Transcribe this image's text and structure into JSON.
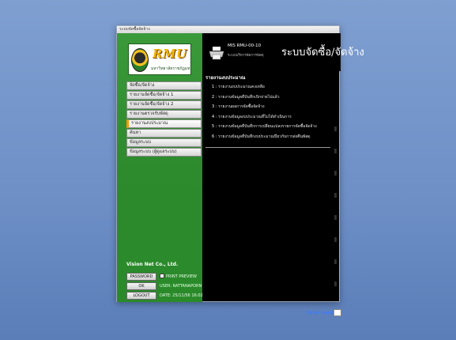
{
  "window": {
    "title": "ระบบจัดซื้อจัดจ้าง"
  },
  "logo": {
    "brand": "RMU",
    "subtitle": "มหาวิทยาลัยราชภัฏมหาสารคาม"
  },
  "sidebar": {
    "items": [
      {
        "label": "จัดซื้อ/จัดจ้าง",
        "active": false
      },
      {
        "label": "รายงานจัดซื้อ/จัดจ้าง 1",
        "active": false
      },
      {
        "label": "รายงานจัดซื้อ/จัดจ้าง 2",
        "active": false
      },
      {
        "label": "รายงานตรวจรับพัสดุ",
        "active": false
      },
      {
        "label": "รายงานงบประมาณ",
        "active": true
      },
      {
        "label": "ค้นหา",
        "active": false
      },
      {
        "label": "ข้อมูลระบบ",
        "active": false
      },
      {
        "label": "ข้อมูลระบบ (ผู้ดูแลระบบ)",
        "active": false
      }
    ],
    "company": "Vision Net Co., Ltd.",
    "password_button": "PASSWORD",
    "print_preview_label": "PRINT PREVIEW",
    "ok_button": "OK",
    "user_text": "USER: RATTANAPORN",
    "logout_button": "LOGOUT",
    "date_text": "DATE: 25/11/56 16:02"
  },
  "header": {
    "code": "MIS RMU-00-10",
    "subtitle": "ระบบบริหารจัดการพัสดุ",
    "title": "ระบบจัดซื้อ/จัดจ้าง"
  },
  "content": {
    "section_heading": "รายงานงบประมาณ",
    "reports": [
      {
        "num": "1",
        "label": "รายงานงบประมาณคงเหลือ"
      },
      {
        "num": "2",
        "label": "รายงานข้อมูลที่บันทึกเบิกจ่ายไปแล้ว"
      },
      {
        "num": "3",
        "label": "รายงานผลการจัดซื้อจัดจ้าง"
      },
      {
        "num": "4",
        "label": "รายงานข้อมูลงบประมาณที่ไม่ได้ดำเนินการ"
      },
      {
        "num": "5",
        "label": "รายงานข้อมูลที่บันทึกการเปลี่ยนแปลงรายการจัดซื้อจัดจ้าง"
      },
      {
        "num": "6",
        "label": "รายงานข้อมูลที่บันทึกงบประมาณปี่ยวกับการส่งคืนพัสดุ"
      }
    ],
    "enter_label": "Enter number"
  },
  "colors": {
    "sidebar_green": "#2d8a2d",
    "brand_gold": "#f3b400",
    "enter_blue": "#3d7bff"
  }
}
